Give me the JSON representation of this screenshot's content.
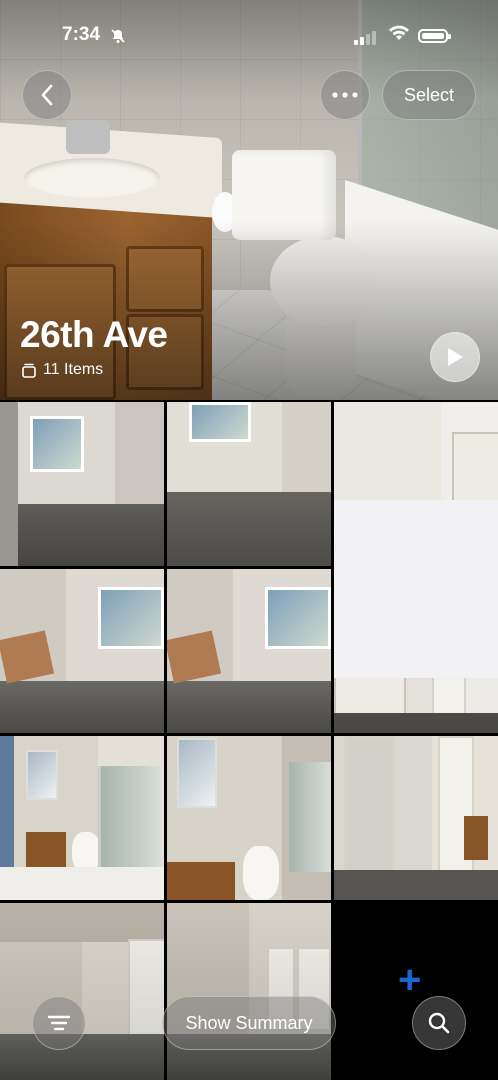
{
  "status_bar": {
    "time": "7:34"
  },
  "header": {
    "select_label": "Select"
  },
  "album": {
    "title": "26th Ave",
    "item_count": "11 Items"
  },
  "bottom_bar": {
    "summary_label": "Show Summary"
  },
  "colors": {
    "accent": "#1a6fe0"
  }
}
